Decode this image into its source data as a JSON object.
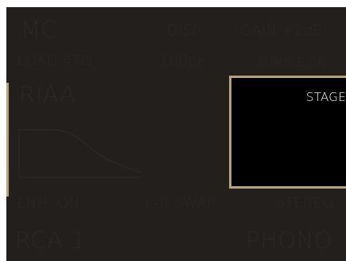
{
  "top_row": {
    "cartridge": "MC",
    "display": "DISP",
    "gain": "GAIN +2dB"
  },
  "second_row": {
    "load": "LOAD 47Ω",
    "capacitance": "100pF",
    "rumble": "RUMBLE ON"
  },
  "eq": {
    "curve_name": "RIAA"
  },
  "stage_panel": {
    "label": "STAGE"
  },
  "status_row": {
    "enhance": "ENH. ON",
    "swap": "L-R SWAP",
    "mode": "STEREO"
  },
  "bottom_row": {
    "input": "RCA 1",
    "source": "PHONO"
  },
  "colors": {
    "background": "#221f1c",
    "dim_text": "#2b2724",
    "accent_gold": "#b3a47f",
    "active_text": "#ffffff",
    "panel_fill": "#000000"
  }
}
